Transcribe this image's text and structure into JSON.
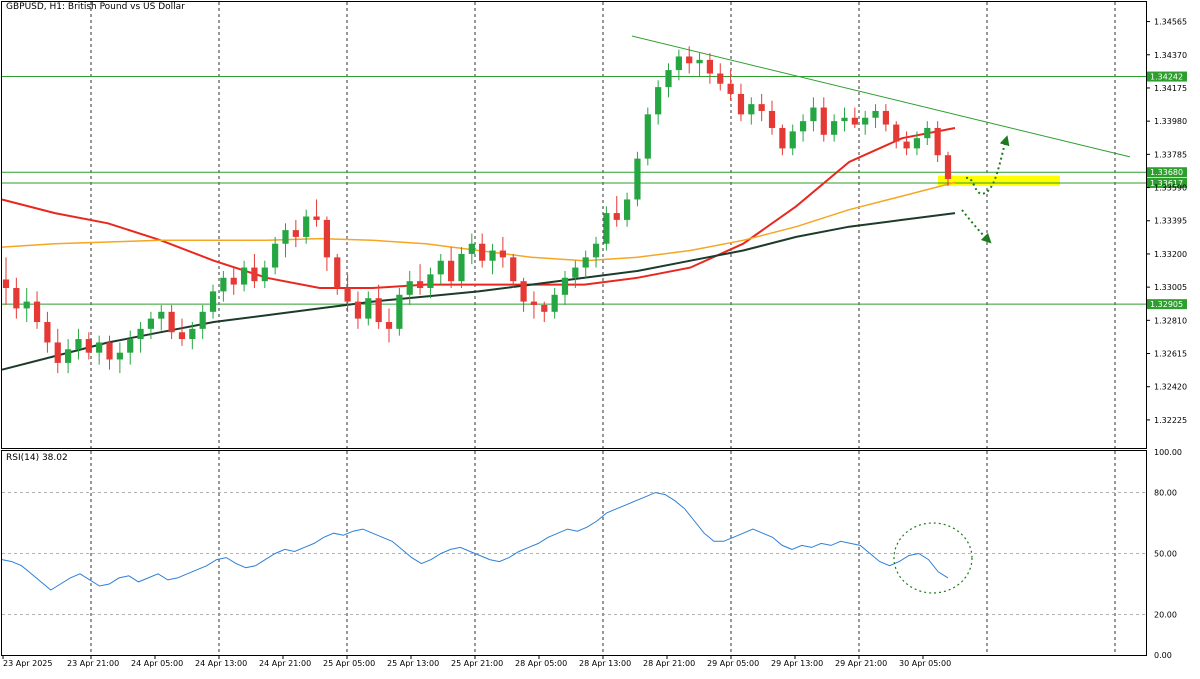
{
  "header": {
    "symbol": "GBPUSD",
    "timeframe": "H1",
    "description": "British Pound vs US Dollar",
    "title": "GBPUSD, H1:  British Pound vs US Dollar"
  },
  "rsi_panel": {
    "label": "RSI(14) 38.02",
    "period": 14,
    "value": 38.02
  },
  "colors": {
    "background": "#ffffff",
    "bull_candle": "#26a642",
    "bear_candle": "#e53935",
    "ema_red": "#e8281f",
    "ma_orange": "#f5a623",
    "ma_dark": "#1c3b2a",
    "trendline": "#2e9e2e",
    "horizontal_level": "#2e9e2e",
    "highlight_zone": "#ffff00",
    "arrow": "#1e7a1e",
    "rsi_line": "#2e7fd8",
    "price_tag_bg": "#2e9e2e",
    "price_tag_text": "#ffffff",
    "grid": "#000000"
  },
  "chart_data": {
    "type": "candlestick",
    "price_axis": {
      "ticks": [
        "1.34565",
        "1.34370",
        "1.34175",
        "1.33980",
        "1.33785",
        "1.33590",
        "1.33395",
        "1.33200",
        "1.33005",
        "1.32810",
        "1.32615",
        "1.32420",
        "1.32225"
      ],
      "tagged_levels": [
        "1.34242",
        "1.33680",
        "1.33617",
        "1.32905"
      ],
      "ylim": [
        1.3206,
        1.3468
      ]
    },
    "time_axis": {
      "labels": [
        "23 Apr 2025",
        "23 Apr 21:00",
        "24 Apr 05:00",
        "24 Apr 13:00",
        "24 Apr 21:00",
        "25 Apr 05:00",
        "25 Apr 13:00",
        "25 Apr 21:00",
        "28 Apr 05:00",
        "28 Apr 13:00",
        "28 Apr 21:00",
        "29 Apr 05:00",
        "29 Apr 13:00",
        "29 Apr 21:00",
        "30 Apr 05:00"
      ]
    },
    "candles": [
      [
        1.3305,
        1.3318,
        1.329,
        1.33
      ],
      [
        1.33,
        1.3306,
        1.3282,
        1.3288
      ],
      [
        1.3288,
        1.33,
        1.328,
        1.3292
      ],
      [
        1.3292,
        1.3298,
        1.3276,
        1.328
      ],
      [
        1.328,
        1.3286,
        1.3262,
        1.3268
      ],
      [
        1.3268,
        1.3276,
        1.325,
        1.3256
      ],
      [
        1.3256,
        1.327,
        1.325,
        1.3264
      ],
      [
        1.3264,
        1.3276,
        1.3258,
        1.327
      ],
      [
        1.327,
        1.3274,
        1.3258,
        1.3262
      ],
      [
        1.3262,
        1.3272,
        1.3255,
        1.3268
      ],
      [
        1.3268,
        1.3272,
        1.3252,
        1.3258
      ],
      [
        1.3258,
        1.3268,
        1.325,
        1.3262
      ],
      [
        1.3262,
        1.3275,
        1.3255,
        1.327
      ],
      [
        1.327,
        1.328,
        1.3262,
        1.3276
      ],
      [
        1.3276,
        1.3286,
        1.327,
        1.3282
      ],
      [
        1.3282,
        1.329,
        1.3275,
        1.3286
      ],
      [
        1.3286,
        1.329,
        1.327,
        1.3274
      ],
      [
        1.3274,
        1.3282,
        1.3266,
        1.327
      ],
      [
        1.327,
        1.328,
        1.3264,
        1.3276
      ],
      [
        1.3276,
        1.329,
        1.327,
        1.3286
      ],
      [
        1.3286,
        1.3302,
        1.3282,
        1.3298
      ],
      [
        1.3298,
        1.331,
        1.3292,
        1.3306
      ],
      [
        1.3306,
        1.3312,
        1.3296,
        1.3302
      ],
      [
        1.3302,
        1.3316,
        1.3298,
        1.3312
      ],
      [
        1.3312,
        1.332,
        1.33,
        1.3304
      ],
      [
        1.3304,
        1.3316,
        1.33,
        1.3312
      ],
      [
        1.3312,
        1.333,
        1.3308,
        1.3326
      ],
      [
        1.3326,
        1.3338,
        1.3318,
        1.3334
      ],
      [
        1.3334,
        1.334,
        1.3324,
        1.333
      ],
      [
        1.333,
        1.3346,
        1.3326,
        1.3342
      ],
      [
        1.3342,
        1.3352,
        1.3336,
        1.334
      ],
      [
        1.334,
        1.3342,
        1.331,
        1.3318
      ],
      [
        1.3318,
        1.332,
        1.3296,
        1.33
      ],
      [
        1.33,
        1.3308,
        1.3286,
        1.3292
      ],
      [
        1.3292,
        1.3298,
        1.3276,
        1.3282
      ],
      [
        1.3282,
        1.3298,
        1.3278,
        1.3294
      ],
      [
        1.3294,
        1.3302,
        1.3276,
        1.328
      ],
      [
        1.328,
        1.3288,
        1.3268,
        1.3276
      ],
      [
        1.3276,
        1.33,
        1.3272,
        1.3296
      ],
      [
        1.3296,
        1.331,
        1.329,
        1.3304
      ],
      [
        1.3304,
        1.3314,
        1.3296,
        1.33
      ],
      [
        1.33,
        1.3312,
        1.3294,
        1.3308
      ],
      [
        1.3308,
        1.332,
        1.3302,
        1.3316
      ],
      [
        1.3316,
        1.3324,
        1.33,
        1.3304
      ],
      [
        1.3304,
        1.3324,
        1.33,
        1.332
      ],
      [
        1.332,
        1.3332,
        1.3314,
        1.3326
      ],
      [
        1.3326,
        1.3332,
        1.3312,
        1.3316
      ],
      [
        1.3316,
        1.3326,
        1.3308,
        1.3322
      ],
      [
        1.3322,
        1.333,
        1.3312,
        1.3318
      ],
      [
        1.3318,
        1.332,
        1.33,
        1.3304
      ],
      [
        1.3304,
        1.3306,
        1.3286,
        1.3292
      ],
      [
        1.3292,
        1.3298,
        1.3282,
        1.329
      ],
      [
        1.329,
        1.3292,
        1.328,
        1.3286
      ],
      [
        1.3286,
        1.33,
        1.3282,
        1.3296
      ],
      [
        1.3296,
        1.331,
        1.329,
        1.3306
      ],
      [
        1.3306,
        1.3316,
        1.33,
        1.3312
      ],
      [
        1.3312,
        1.3322,
        1.3306,
        1.3318
      ],
      [
        1.3318,
        1.333,
        1.3312,
        1.3326
      ],
      [
        1.3326,
        1.3348,
        1.3322,
        1.3344
      ],
      [
        1.3344,
        1.3354,
        1.3336,
        1.334
      ],
      [
        1.334,
        1.3356,
        1.3336,
        1.3352
      ],
      [
        1.3352,
        1.338,
        1.3348,
        1.3376
      ],
      [
        1.3376,
        1.3406,
        1.3372,
        1.3402
      ],
      [
        1.3402,
        1.3422,
        1.3396,
        1.3418
      ],
      [
        1.3418,
        1.3432,
        1.3412,
        1.3428
      ],
      [
        1.3428,
        1.344,
        1.3422,
        1.3436
      ],
      [
        1.3436,
        1.3442,
        1.3426,
        1.3432
      ],
      [
        1.3432,
        1.3438,
        1.3424,
        1.3434
      ],
      [
        1.3434,
        1.3438,
        1.342,
        1.3426
      ],
      [
        1.3426,
        1.3432,
        1.3416,
        1.342
      ],
      [
        1.342,
        1.3428,
        1.341,
        1.3414
      ],
      [
        1.3414,
        1.342,
        1.3398,
        1.3402
      ],
      [
        1.3402,
        1.3412,
        1.3396,
        1.3408
      ],
      [
        1.3408,
        1.3414,
        1.3398,
        1.3404
      ],
      [
        1.3404,
        1.341,
        1.339,
        1.3394
      ],
      [
        1.3394,
        1.3396,
        1.3378,
        1.3382
      ],
      [
        1.3382,
        1.3396,
        1.3378,
        1.3392
      ],
      [
        1.3392,
        1.3402,
        1.3386,
        1.3398
      ],
      [
        1.3398,
        1.3412,
        1.3392,
        1.3406
      ],
      [
        1.3406,
        1.3412,
        1.3386,
        1.339
      ],
      [
        1.339,
        1.3402,
        1.3386,
        1.3398
      ],
      [
        1.3398,
        1.3406,
        1.3392,
        1.34
      ],
      [
        1.34,
        1.3406,
        1.3394,
        1.3396
      ],
      [
        1.3396,
        1.3404,
        1.339,
        1.34
      ],
      [
        1.34,
        1.3408,
        1.3394,
        1.3404
      ],
      [
        1.3404,
        1.3408,
        1.3392,
        1.3396
      ],
      [
        1.3396,
        1.3398,
        1.3382,
        1.3386
      ],
      [
        1.3386,
        1.3392,
        1.3378,
        1.3382
      ],
      [
        1.3382,
        1.3392,
        1.3378,
        1.3388
      ],
      [
        1.3388,
        1.3398,
        1.3384,
        1.3394
      ],
      [
        1.3394,
        1.3398,
        1.3374,
        1.3378
      ],
      [
        1.3378,
        1.338,
        1.336,
        1.3364
      ]
    ],
    "moving_averages": [
      {
        "color_key": "ema_red",
        "values": [
          1.3352,
          1.3344,
          1.3338,
          1.3328,
          1.3316,
          1.3306,
          1.33,
          1.33,
          1.3302,
          1.3302,
          1.3302,
          1.3302,
          1.3306,
          1.3312,
          1.3326,
          1.3348,
          1.3374,
          1.3388,
          1.3394
        ]
      },
      {
        "color_key": "ma_orange",
        "values": [
          1.3324,
          1.3326,
          1.3327,
          1.3328,
          1.3328,
          1.3328,
          1.3329,
          1.3328,
          1.3326,
          1.3322,
          1.3318,
          1.3316,
          1.3318,
          1.3322,
          1.3328,
          1.3336,
          1.3346,
          1.3354,
          1.3362
        ]
      },
      {
        "color_key": "ma_dark",
        "values": [
          1.3252,
          1.326,
          1.3268,
          1.3274,
          1.328,
          1.3284,
          1.3288,
          1.3292,
          1.3295,
          1.3298,
          1.3302,
          1.3306,
          1.331,
          1.3316,
          1.3322,
          1.333,
          1.3336,
          1.334,
          1.3344
        ]
      }
    ],
    "trendline": {
      "start_price": 1.3448,
      "end_price": 1.3377
    },
    "horizontal_levels": [
      1.34242,
      1.3368,
      1.33617,
      1.32905
    ],
    "highlight_zone": [
      1.336,
      1.3366
    ],
    "rsi": {
      "ylim": [
        0,
        100
      ],
      "levels": [
        20,
        50,
        80
      ],
      "ticks": [
        "100.00",
        "80.00",
        "50.00",
        "20.00",
        "0.00"
      ],
      "values": [
        47,
        46,
        44,
        40,
        36,
        32,
        35,
        38,
        40,
        37,
        34,
        35,
        38,
        39,
        36,
        38,
        40,
        37,
        38,
        40,
        42,
        44,
        47,
        48,
        45,
        43,
        44,
        47,
        50,
        52,
        51,
        53,
        55,
        58,
        60,
        59,
        61,
        62,
        60,
        58,
        56,
        52,
        48,
        45,
        47,
        50,
        52,
        53,
        51,
        49,
        47,
        46,
        48,
        51,
        53,
        55,
        58,
        60,
        62,
        61,
        63,
        66,
        70,
        72,
        74,
        76,
        78,
        80,
        79,
        76,
        72,
        66,
        60,
        56,
        56,
        58,
        60,
        62,
        60,
        58,
        54,
        52,
        54,
        53,
        55,
        54,
        56,
        55,
        54,
        50,
        46,
        44,
        46,
        49,
        50,
        47,
        41,
        38
      ]
    }
  }
}
